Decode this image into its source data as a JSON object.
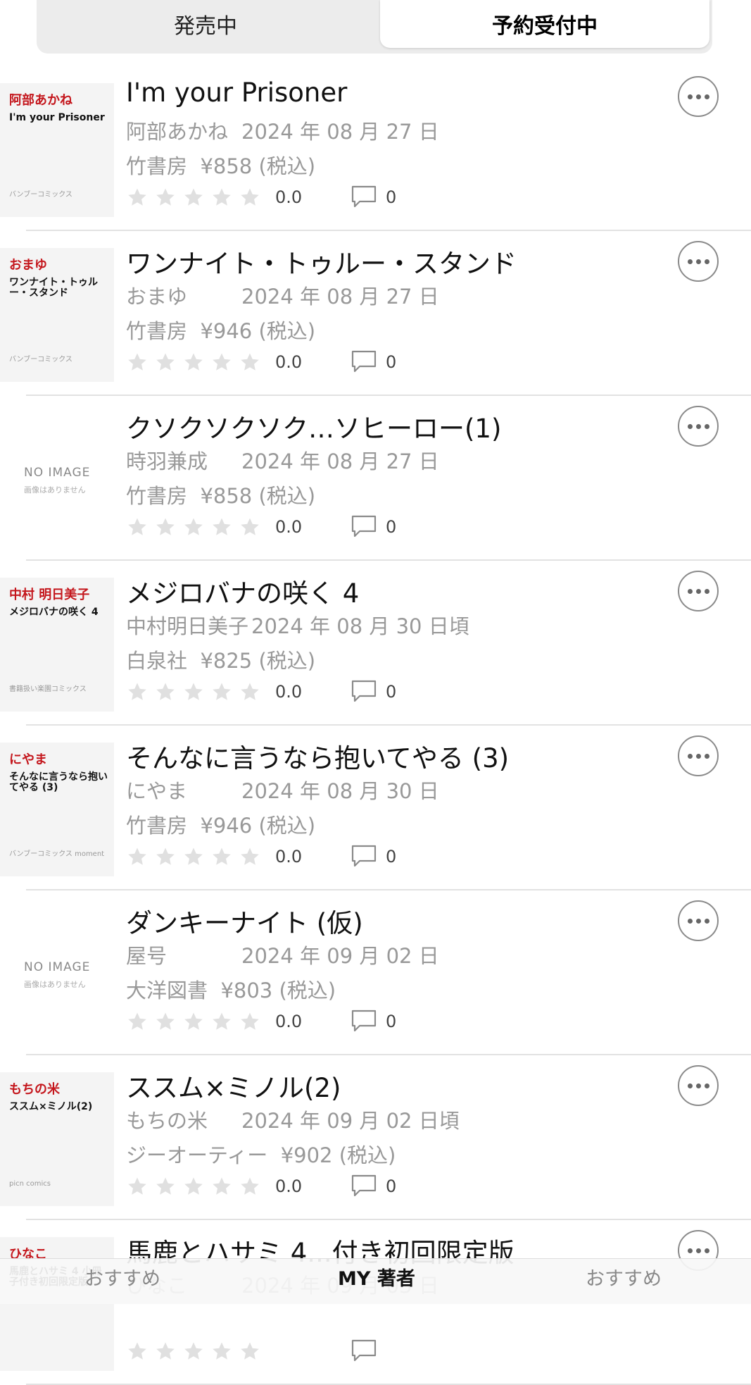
{
  "segments": {
    "left": "発売中",
    "right": "予約受付中"
  },
  "items": [
    {
      "title": "I'm your Prisoner",
      "author": "阿部あかね",
      "date": "2024 年 08 月 27 日",
      "publisher": "竹書房",
      "price": "¥858 (税込)",
      "rating": "0.0",
      "comments": "0",
      "cover": {
        "author": "阿部あかね",
        "title": "I'm your Prisoner",
        "label": "バンブーコミックス"
      }
    },
    {
      "title": "ワンナイト・トゥルー・スタンド",
      "author": "おまゆ",
      "date": "2024 年 08 月 27 日",
      "publisher": "竹書房",
      "price": "¥946 (税込)",
      "rating": "0.0",
      "comments": "0",
      "cover": {
        "author": "おまゆ",
        "title": "ワンナイト・トゥルー・スタンド",
        "label": "バンブーコミックス"
      }
    },
    {
      "title": "クソクソクソク…ソヒーロー(1)",
      "author": "時羽兼成",
      "date": "2024 年 08 月 27 日",
      "publisher": "竹書房",
      "price": "¥858 (税込)",
      "rating": "0.0",
      "comments": "0",
      "noimage": {
        "text": "NO IMAGE",
        "sub": "画像はありません"
      }
    },
    {
      "title": "メジロバナの咲く 4",
      "author": "中村明日美子",
      "date": "2024 年 08 月 30 日頃",
      "publisher": "白泉社",
      "price": "¥825 (税込)",
      "rating": "0.0",
      "comments": "0",
      "cover": {
        "author": "中村 明日美子",
        "title": "メジロバナの咲く 4",
        "label": "書籍扱い楽園コミックス"
      }
    },
    {
      "title": "そんなに言うなら抱いてやる (3)",
      "author": "にやま",
      "date": "2024 年 08 月 30 日",
      "publisher": "竹書房",
      "price": "¥946 (税込)",
      "rating": "0.0",
      "comments": "0",
      "cover": {
        "author": "にやま",
        "title": "そんなに言うなら抱いてやる (3)",
        "label": "バンブーコミックス moment"
      }
    },
    {
      "title": "ダンキーナイト (仮)",
      "author": "屋号",
      "date": "2024 年 09 月 02 日",
      "publisher": "大洋図書",
      "price": "¥803 (税込)",
      "rating": "0.0",
      "comments": "0",
      "noimage": {
        "text": "NO IMAGE",
        "sub": "画像はありません"
      }
    },
    {
      "title": "ススム×ミノル(2)",
      "author": "もちの米",
      "date": "2024 年 09 月 02 日頃",
      "publisher": "ジーオーティー",
      "price": "¥902 (税込)",
      "rating": "0.0",
      "comments": "0",
      "cover": {
        "author": "もちの米",
        "title": "ススム×ミノル(2)",
        "label": "picn comics"
      }
    },
    {
      "title": "馬鹿とハサミ 4...付き初回限定版",
      "author": "ひなこ",
      "date": "2024 年 09 月 03 日",
      "publisher": "",
      "price": "",
      "rating": "",
      "comments": "",
      "cover": {
        "author": "ひなこ",
        "title": "馬鹿とハサミ 4 小冊子付き初回限定版",
        "label": ""
      }
    }
  ],
  "tabbar": {
    "left": "おすすめ",
    "center": "MY 著者",
    "right": "おすすめ"
  }
}
